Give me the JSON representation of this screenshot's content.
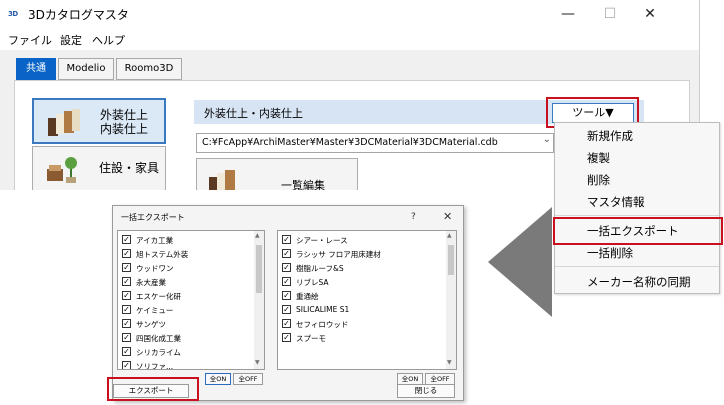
{
  "window": {
    "title": "3Dカタログマスタ",
    "app_icon_text": "3D",
    "controls": [
      "—",
      "☐",
      "✕"
    ]
  },
  "menu": [
    "ファイル",
    "設定",
    "ヘルプ"
  ],
  "tabs": [
    {
      "label": "共通",
      "active": true
    },
    {
      "label": "Modelio",
      "active": false
    },
    {
      "label": "Roomo3D",
      "active": false
    }
  ],
  "categories": [
    {
      "label_line1": "外装仕上",
      "label_line2": "内装仕上",
      "selected": true
    },
    {
      "label_line1": "住設・家具",
      "label_line2": "",
      "selected": false
    }
  ],
  "section": {
    "title": "外装仕上・内装仕上",
    "tool_button": "ツール▼",
    "path_value": "C:¥FcApp¥ArchiMaster¥Master¥3DCMaterial¥3DCMaterial.cdb",
    "bulk_edit_label": "一覧編集"
  },
  "tool_menu": {
    "items": [
      "新規作成",
      "複製",
      "削除",
      "マスタ情報",
      "一括エクスポート",
      "一括削除",
      "メーカー名称の同期"
    ],
    "highlighted": "一括エクスポート"
  },
  "dialog": {
    "title": "一括エクスポート",
    "help": "?",
    "close": "✕",
    "left_list": [
      "アイカ工業",
      "旭トステム外装",
      "ウッドワン",
      "永大産業",
      "エスケー化研",
      "ケイミュー",
      "サンゲツ",
      "四国化成工業",
      "シリカライム",
      "ソリファ..."
    ],
    "right_list": [
      "シアー・レース",
      "ラシッサ フロア用床建材",
      "樹脂ルーフ&S",
      "リブレSA",
      "重通絵",
      "SILICALIME S1",
      "セフィロウッド",
      "スプーモ"
    ],
    "all_on": "全ON",
    "all_off": "全OFF",
    "export_button": "エクスポート",
    "close_button": "閉じる"
  },
  "colors": {
    "accent": "#0a64c8",
    "highlight_red": "#c8101e",
    "arrow": "#7a7a7a"
  }
}
